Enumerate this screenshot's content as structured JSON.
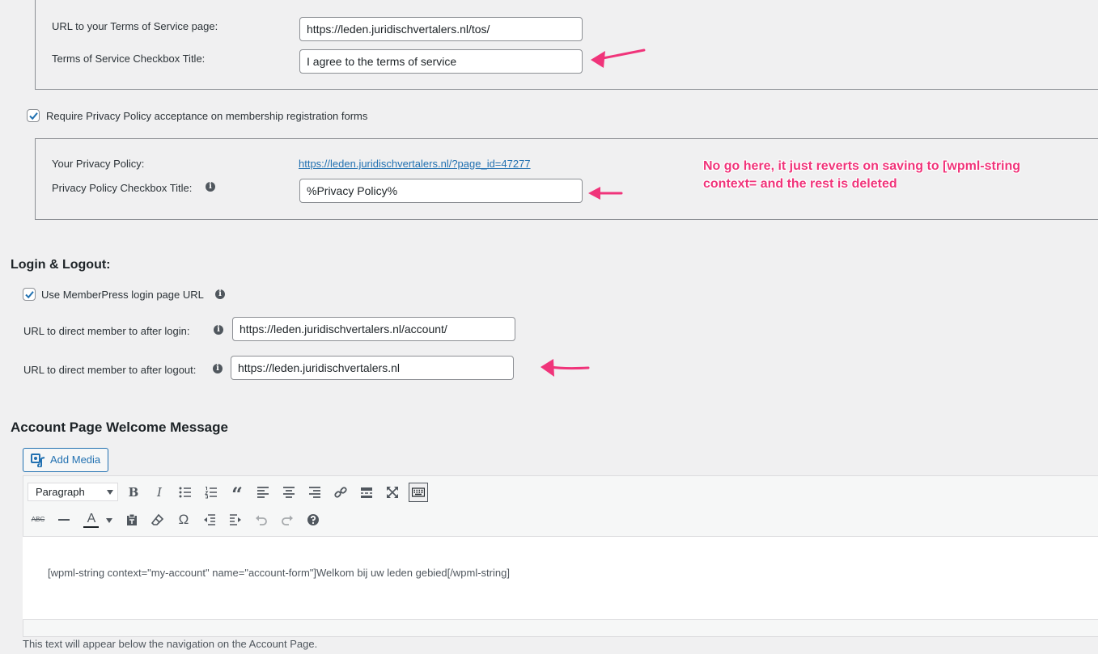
{
  "tos": {
    "url_label": "URL to your Terms of Service page:",
    "url_value": "https://leden.juridischvertalers.nl/tos/",
    "checkbox_title_label": "Terms of Service Checkbox Title:",
    "checkbox_title_value": "I agree to the terms of service"
  },
  "privacy": {
    "require_label": "Require Privacy Policy acceptance on membership registration forms",
    "require_checked": true,
    "policy_label": "Your Privacy Policy:",
    "policy_link": "https://leden.juridischvertalers.nl/?page_id=47277",
    "checkbox_title_label": "Privacy Policy Checkbox Title:",
    "checkbox_title_value": "%Privacy Policy%"
  },
  "annotation": {
    "line1": "No go here, it just reverts on saving to [wpml-string",
    "line2": "context=  and the rest is deleted",
    "color": "#f0347a"
  },
  "login": {
    "heading": "Login & Logout:",
    "use_login_label": "Use MemberPress login page URL",
    "use_login_checked": true,
    "after_login_label": "URL to direct member to after login:",
    "after_login_value": "https://leden.juridischvertalers.nl/account/",
    "after_logout_label": "URL to direct member to after logout:",
    "after_logout_value": "https://leden.juridischvertalers.nl"
  },
  "welcome": {
    "heading": "Account Page Welcome Message",
    "add_media_label": "Add Media",
    "format_select": "Paragraph",
    "content": "[wpml-string context=\"my-account\" name=\"account-form\"]Welkom bij uw leden gebied[/wpml-string]",
    "help_text": "This text will appear below the navigation on the Account Page."
  },
  "toolbar_row1": [
    "bold-icon",
    "italic-icon",
    "bullet-list-icon",
    "numbered-list-icon",
    "blockquote-icon",
    "align-left-icon",
    "align-center-icon",
    "align-right-icon",
    "link-icon",
    "read-more-icon",
    "fullscreen-icon",
    "toolbar-toggle-icon"
  ],
  "toolbar_row2": [
    "strikethrough-icon",
    "horizontal-line-icon",
    "text-color-icon",
    "paste-text-icon",
    "clear-formatting-icon",
    "special-character-icon",
    "outdent-icon",
    "indent-icon",
    "undo-icon",
    "redo-icon",
    "help-icon"
  ],
  "colors": {
    "accent": "#2271b1",
    "arrow": "#f0347a"
  }
}
